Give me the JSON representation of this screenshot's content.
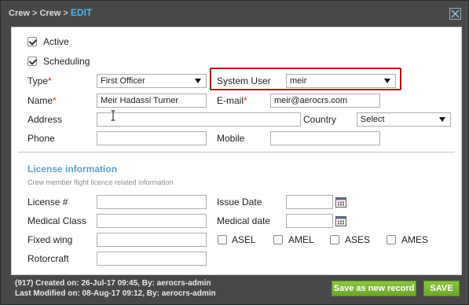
{
  "title": {
    "crumb1": "Crew",
    "sep": " > ",
    "crumb2": "Crew",
    "current": "EDIT"
  },
  "checkboxes": [
    {
      "label": "Active",
      "checked": true
    },
    {
      "label": "Scheduling",
      "checked": true
    }
  ],
  "fields": {
    "type_label": "Type",
    "type_value": "First Officer",
    "system_user_label": "System User",
    "system_user_value": "meir",
    "name_label": "Name",
    "name_value": "Meir Hadassi Turner",
    "email_label": "E-mail",
    "email_value": "meir@aerocrs.com",
    "address_label": "Address",
    "address_value": "",
    "country_label": "Country",
    "country_value": "Select",
    "phone_label": "Phone",
    "phone_value": "",
    "mobile_label": "Mobile",
    "mobile_value": "",
    "required_mark": "*"
  },
  "license": {
    "title": "License information",
    "subtitle": "Crew member flight licence related information",
    "license_no_label": "License #",
    "license_no_value": "",
    "issue_date_label": "Issue Date",
    "issue_date_value": "",
    "medical_class_label": "Medical Class",
    "medical_class_value": "",
    "medical_date_label": "Medical date",
    "medical_date_value": "",
    "fixed_wing_label": "Fixed wing",
    "fixed_wing_value": "",
    "rotorcraft_label": "Rotorcraft",
    "rotorcraft_value": "",
    "ratings": [
      {
        "label": "ASEL",
        "checked": false
      },
      {
        "label": "AMEL",
        "checked": false
      },
      {
        "label": "ASES",
        "checked": false
      },
      {
        "label": "AMES",
        "checked": false
      }
    ]
  },
  "footer": {
    "created": "(917) Created on: 26-Jul-17 09:45, By: aerocrs-admin",
    "modified": "Last Modified on: 08-Aug-17 09:12, By: aerocrs-admin"
  },
  "buttons": {
    "save_new": "Save as new record",
    "save": "SAVE"
  },
  "icons": {
    "close": "close-icon",
    "calendar": "calendar-icon",
    "dropdown": "chevron-down-icon",
    "cursor": "text-cursor-icon"
  },
  "colors": {
    "accent": "#4eb4e6",
    "required": "#d9251c",
    "highlight": "#b30f14",
    "button": "#7ab536",
    "section": "#5aa3d6"
  }
}
